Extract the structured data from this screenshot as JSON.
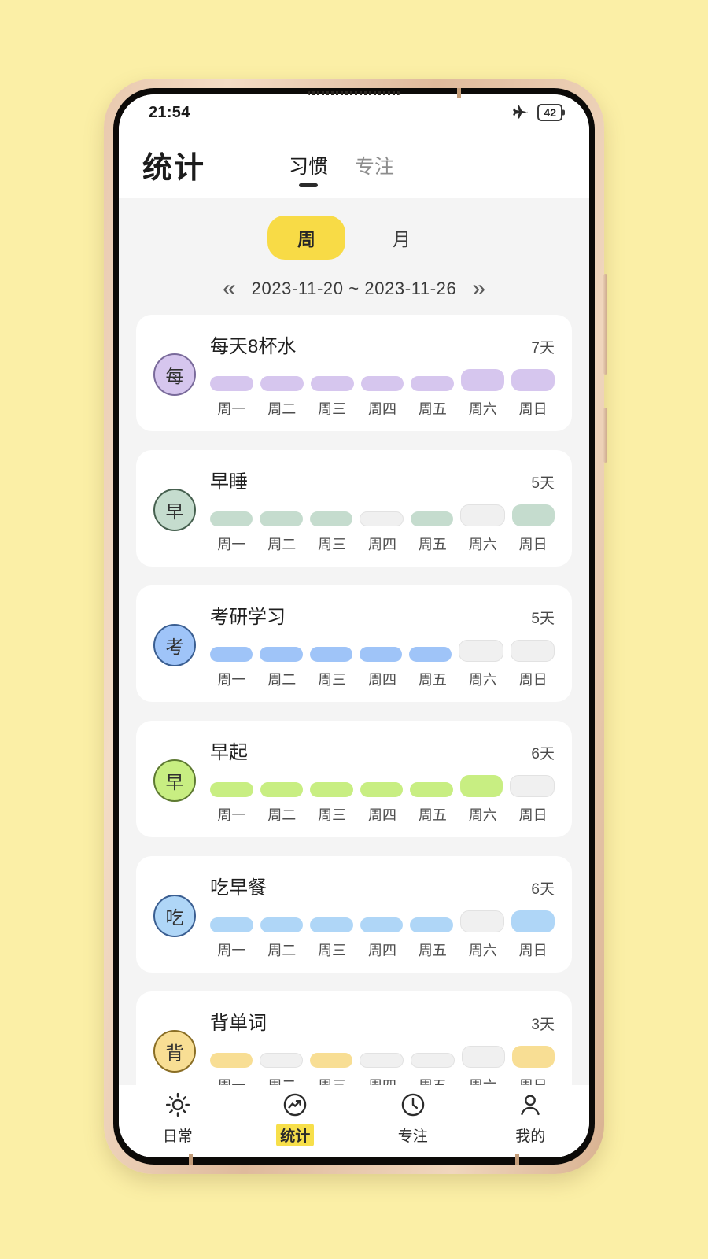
{
  "status_bar": {
    "time": "21:54",
    "airplane_icon": "airplane-mode-icon",
    "battery_level": "42"
  },
  "header": {
    "title": "统计",
    "tabs": [
      {
        "label": "习惯",
        "active": true
      },
      {
        "label": "专注",
        "active": false
      }
    ]
  },
  "range_panel": {
    "periods": [
      {
        "label": "周",
        "active": true
      },
      {
        "label": "月",
        "active": false
      }
    ],
    "prev_arrow": "«",
    "next_arrow": "»",
    "date_range": "2023-11-20  ~  2023-11-26"
  },
  "day_labels": [
    "周一",
    "周二",
    "周三",
    "周四",
    "周五",
    "周六",
    "周日"
  ],
  "habits": [
    {
      "avatar_char": "每",
      "name": "每天8杯水",
      "streak": "7天",
      "fill_color": "#D6C6EE",
      "border_color": "#7A6B9B",
      "days": [
        true,
        true,
        true,
        true,
        true,
        true,
        true
      ]
    },
    {
      "avatar_char": "早",
      "name": "早睡",
      "streak": "5天",
      "fill_color": "#C5DCCE",
      "border_color": "#46604F",
      "days": [
        true,
        true,
        true,
        false,
        true,
        false,
        true
      ]
    },
    {
      "avatar_char": "考",
      "name": "考研学习",
      "streak": "5天",
      "fill_color": "#9FC4F8",
      "border_color": "#3A5E91",
      "days": [
        true,
        true,
        true,
        true,
        true,
        false,
        false
      ]
    },
    {
      "avatar_char": "早",
      "name": "早起",
      "streak": "6天",
      "fill_color": "#C8EE82",
      "border_color": "#5E7A32",
      "days": [
        true,
        true,
        true,
        true,
        true,
        true,
        false
      ]
    },
    {
      "avatar_char": "吃",
      "name": "吃早餐",
      "streak": "6天",
      "fill_color": "#AFD6F7",
      "border_color": "#3A5E91",
      "days": [
        true,
        true,
        true,
        true,
        true,
        false,
        true
      ]
    },
    {
      "avatar_char": "背",
      "name": "背单词",
      "streak": "3天",
      "fill_color": "#F8DE94",
      "border_color": "#8A6E25",
      "days": [
        true,
        false,
        true,
        false,
        false,
        false,
        true
      ]
    }
  ],
  "bottom_nav": [
    {
      "label": "日常",
      "icon": "sun-icon",
      "active": false
    },
    {
      "label": "统计",
      "icon": "chart-trend-circle-icon",
      "active": true
    },
    {
      "label": "专注",
      "icon": "clock-icon",
      "active": false
    },
    {
      "label": "我的",
      "icon": "person-icon",
      "active": false
    }
  ],
  "theme": {
    "page_background": "#FBEFA6",
    "accent_yellow": "#F8DB46",
    "panel_gray": "#F4F4F4",
    "empty_bar": "#F0F0F0"
  }
}
